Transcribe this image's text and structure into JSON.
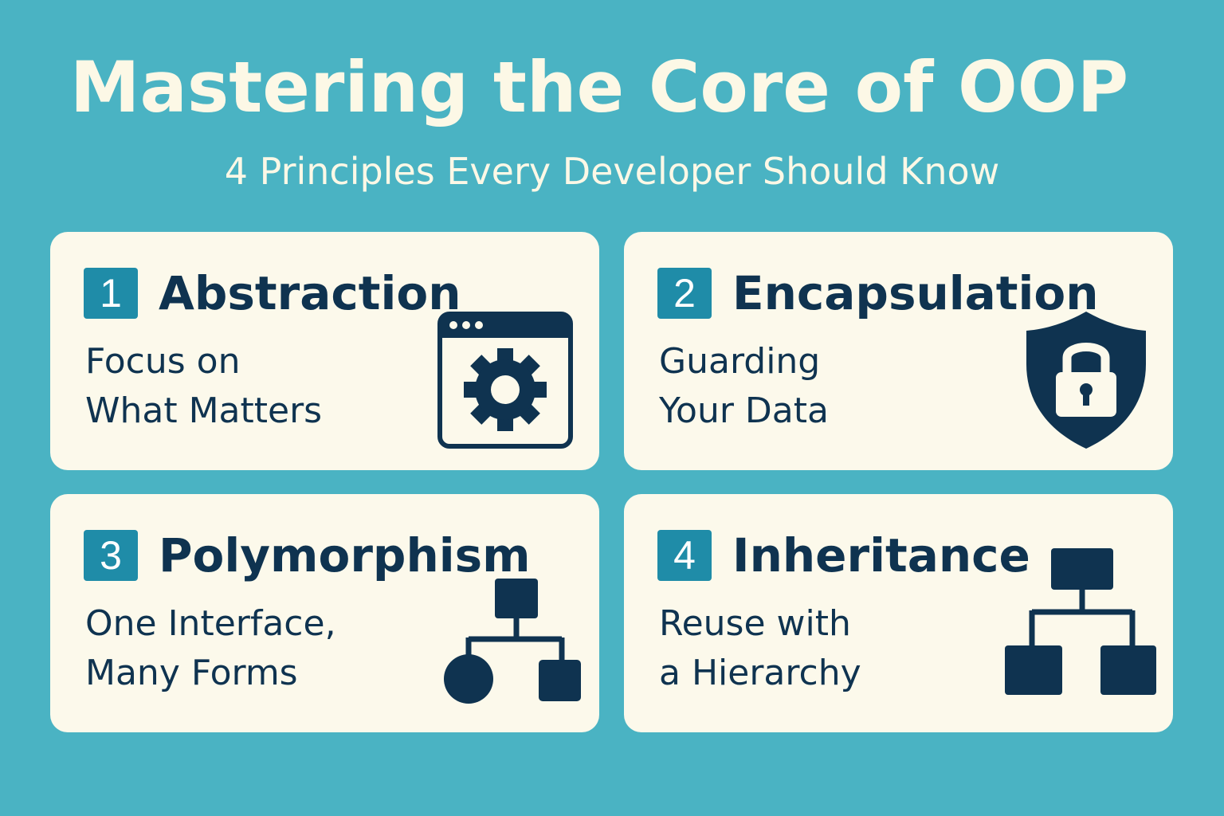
{
  "header": {
    "title": "Mastering the Core of OOP",
    "subtitle": "4 Principles Every Developer Should Know"
  },
  "colors": {
    "background": "#4ab3c3",
    "card": "#fcf9eb",
    "badge": "#1f8ca8",
    "ink": "#0f3350",
    "heading_text": "#fcf8e6"
  },
  "cards": [
    {
      "number": "1",
      "title": "Abstraction",
      "desc_line1": "Focus on",
      "desc_line2": "What Matters",
      "icon": "window-gear-icon"
    },
    {
      "number": "2",
      "title": "Encapsulation",
      "desc_line1": "Guarding",
      "desc_line2": "Your Data",
      "icon": "shield-lock-icon"
    },
    {
      "number": "3",
      "title": "Polymorphism",
      "desc_line1": "One Interface,",
      "desc_line2": "Many Forms",
      "icon": "shape-tree-icon"
    },
    {
      "number": "4",
      "title": "Inheritance",
      "desc_line1": "Reuse with",
      "desc_line2": "a Hierarchy",
      "icon": "hierarchy-icon"
    }
  ]
}
